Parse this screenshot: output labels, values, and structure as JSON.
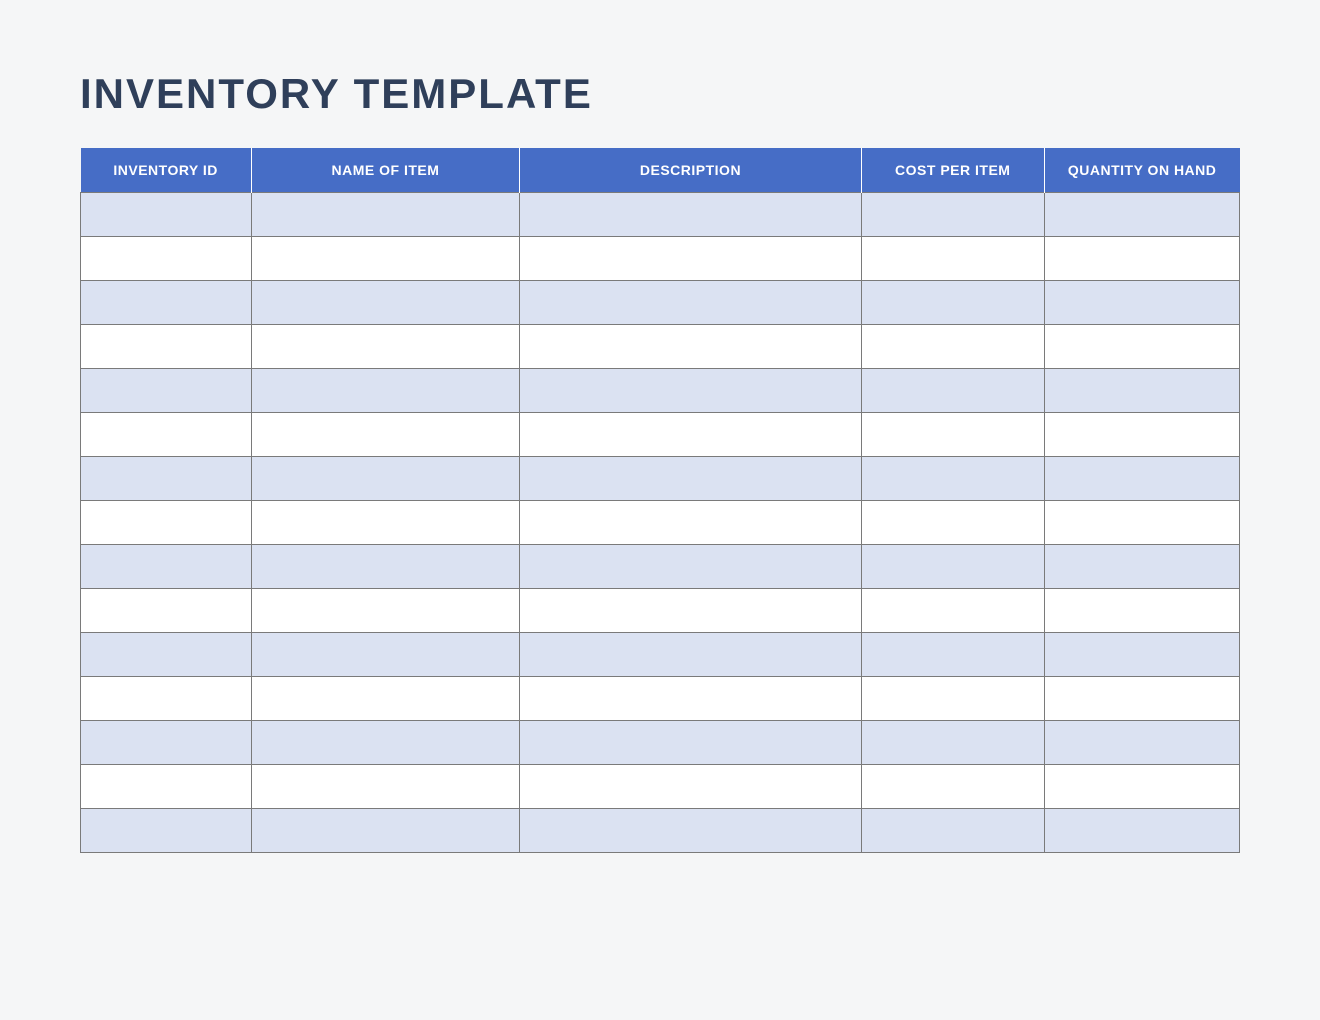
{
  "title": "INVENTORY TEMPLATE",
  "headers": {
    "id": "INVENTORY ID",
    "name": "NAME OF ITEM",
    "description": "DESCRIPTION",
    "cost": "COST PER ITEM",
    "quantity": "QUANTITY ON HAND"
  },
  "rows": [
    {
      "id": "",
      "name": "",
      "description": "",
      "cost": "",
      "quantity": ""
    },
    {
      "id": "",
      "name": "",
      "description": "",
      "cost": "",
      "quantity": ""
    },
    {
      "id": "",
      "name": "",
      "description": "",
      "cost": "",
      "quantity": ""
    },
    {
      "id": "",
      "name": "",
      "description": "",
      "cost": "",
      "quantity": ""
    },
    {
      "id": "",
      "name": "",
      "description": "",
      "cost": "",
      "quantity": ""
    },
    {
      "id": "",
      "name": "",
      "description": "",
      "cost": "",
      "quantity": ""
    },
    {
      "id": "",
      "name": "",
      "description": "",
      "cost": "",
      "quantity": ""
    },
    {
      "id": "",
      "name": "",
      "description": "",
      "cost": "",
      "quantity": ""
    },
    {
      "id": "",
      "name": "",
      "description": "",
      "cost": "",
      "quantity": ""
    },
    {
      "id": "",
      "name": "",
      "description": "",
      "cost": "",
      "quantity": ""
    },
    {
      "id": "",
      "name": "",
      "description": "",
      "cost": "",
      "quantity": ""
    },
    {
      "id": "",
      "name": "",
      "description": "",
      "cost": "",
      "quantity": ""
    },
    {
      "id": "",
      "name": "",
      "description": "",
      "cost": "",
      "quantity": ""
    },
    {
      "id": "",
      "name": "",
      "description": "",
      "cost": "",
      "quantity": ""
    },
    {
      "id": "",
      "name": "",
      "description": "",
      "cost": "",
      "quantity": ""
    }
  ]
}
